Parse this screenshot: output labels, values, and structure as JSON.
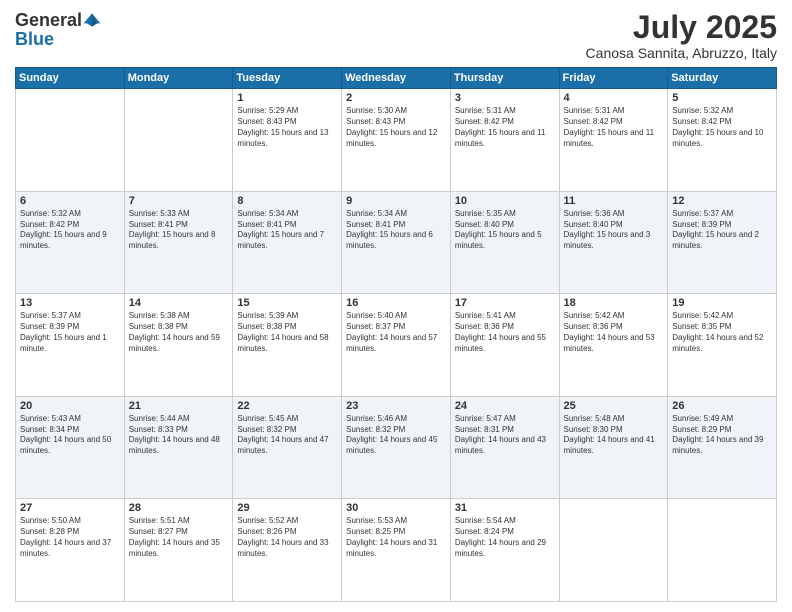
{
  "header": {
    "logo_general": "General",
    "logo_blue": "Blue",
    "month": "July 2025",
    "location": "Canosa Sannita, Abruzzo, Italy"
  },
  "days_of_week": [
    "Sunday",
    "Monday",
    "Tuesday",
    "Wednesday",
    "Thursday",
    "Friday",
    "Saturday"
  ],
  "weeks": [
    [
      {
        "day": "",
        "sunrise": "",
        "sunset": "",
        "daylight": ""
      },
      {
        "day": "",
        "sunrise": "",
        "sunset": "",
        "daylight": ""
      },
      {
        "day": "1",
        "sunrise": "Sunrise: 5:29 AM",
        "sunset": "Sunset: 8:43 PM",
        "daylight": "Daylight: 15 hours and 13 minutes."
      },
      {
        "day": "2",
        "sunrise": "Sunrise: 5:30 AM",
        "sunset": "Sunset: 8:43 PM",
        "daylight": "Daylight: 15 hours and 12 minutes."
      },
      {
        "day": "3",
        "sunrise": "Sunrise: 5:31 AM",
        "sunset": "Sunset: 8:42 PM",
        "daylight": "Daylight: 15 hours and 11 minutes."
      },
      {
        "day": "4",
        "sunrise": "Sunrise: 5:31 AM",
        "sunset": "Sunset: 8:42 PM",
        "daylight": "Daylight: 15 hours and 11 minutes."
      },
      {
        "day": "5",
        "sunrise": "Sunrise: 5:32 AM",
        "sunset": "Sunset: 8:42 PM",
        "daylight": "Daylight: 15 hours and 10 minutes."
      }
    ],
    [
      {
        "day": "6",
        "sunrise": "Sunrise: 5:32 AM",
        "sunset": "Sunset: 8:42 PM",
        "daylight": "Daylight: 15 hours and 9 minutes."
      },
      {
        "day": "7",
        "sunrise": "Sunrise: 5:33 AM",
        "sunset": "Sunset: 8:41 PM",
        "daylight": "Daylight: 15 hours and 8 minutes."
      },
      {
        "day": "8",
        "sunrise": "Sunrise: 5:34 AM",
        "sunset": "Sunset: 8:41 PM",
        "daylight": "Daylight: 15 hours and 7 minutes."
      },
      {
        "day": "9",
        "sunrise": "Sunrise: 5:34 AM",
        "sunset": "Sunset: 8:41 PM",
        "daylight": "Daylight: 15 hours and 6 minutes."
      },
      {
        "day": "10",
        "sunrise": "Sunrise: 5:35 AM",
        "sunset": "Sunset: 8:40 PM",
        "daylight": "Daylight: 15 hours and 5 minutes."
      },
      {
        "day": "11",
        "sunrise": "Sunrise: 5:36 AM",
        "sunset": "Sunset: 8:40 PM",
        "daylight": "Daylight: 15 hours and 3 minutes."
      },
      {
        "day": "12",
        "sunrise": "Sunrise: 5:37 AM",
        "sunset": "Sunset: 8:39 PM",
        "daylight": "Daylight: 15 hours and 2 minutes."
      }
    ],
    [
      {
        "day": "13",
        "sunrise": "Sunrise: 5:37 AM",
        "sunset": "Sunset: 8:39 PM",
        "daylight": "Daylight: 15 hours and 1 minute."
      },
      {
        "day": "14",
        "sunrise": "Sunrise: 5:38 AM",
        "sunset": "Sunset: 8:38 PM",
        "daylight": "Daylight: 14 hours and 59 minutes."
      },
      {
        "day": "15",
        "sunrise": "Sunrise: 5:39 AM",
        "sunset": "Sunset: 8:38 PM",
        "daylight": "Daylight: 14 hours and 58 minutes."
      },
      {
        "day": "16",
        "sunrise": "Sunrise: 5:40 AM",
        "sunset": "Sunset: 8:37 PM",
        "daylight": "Daylight: 14 hours and 57 minutes."
      },
      {
        "day": "17",
        "sunrise": "Sunrise: 5:41 AM",
        "sunset": "Sunset: 8:36 PM",
        "daylight": "Daylight: 14 hours and 55 minutes."
      },
      {
        "day": "18",
        "sunrise": "Sunrise: 5:42 AM",
        "sunset": "Sunset: 8:36 PM",
        "daylight": "Daylight: 14 hours and 53 minutes."
      },
      {
        "day": "19",
        "sunrise": "Sunrise: 5:42 AM",
        "sunset": "Sunset: 8:35 PM",
        "daylight": "Daylight: 14 hours and 52 minutes."
      }
    ],
    [
      {
        "day": "20",
        "sunrise": "Sunrise: 5:43 AM",
        "sunset": "Sunset: 8:34 PM",
        "daylight": "Daylight: 14 hours and 50 minutes."
      },
      {
        "day": "21",
        "sunrise": "Sunrise: 5:44 AM",
        "sunset": "Sunset: 8:33 PM",
        "daylight": "Daylight: 14 hours and 48 minutes."
      },
      {
        "day": "22",
        "sunrise": "Sunrise: 5:45 AM",
        "sunset": "Sunset: 8:32 PM",
        "daylight": "Daylight: 14 hours and 47 minutes."
      },
      {
        "day": "23",
        "sunrise": "Sunrise: 5:46 AM",
        "sunset": "Sunset: 8:32 PM",
        "daylight": "Daylight: 14 hours and 45 minutes."
      },
      {
        "day": "24",
        "sunrise": "Sunrise: 5:47 AM",
        "sunset": "Sunset: 8:31 PM",
        "daylight": "Daylight: 14 hours and 43 minutes."
      },
      {
        "day": "25",
        "sunrise": "Sunrise: 5:48 AM",
        "sunset": "Sunset: 8:30 PM",
        "daylight": "Daylight: 14 hours and 41 minutes."
      },
      {
        "day": "26",
        "sunrise": "Sunrise: 5:49 AM",
        "sunset": "Sunset: 8:29 PM",
        "daylight": "Daylight: 14 hours and 39 minutes."
      }
    ],
    [
      {
        "day": "27",
        "sunrise": "Sunrise: 5:50 AM",
        "sunset": "Sunset: 8:28 PM",
        "daylight": "Daylight: 14 hours and 37 minutes."
      },
      {
        "day": "28",
        "sunrise": "Sunrise: 5:51 AM",
        "sunset": "Sunset: 8:27 PM",
        "daylight": "Daylight: 14 hours and 35 minutes."
      },
      {
        "day": "29",
        "sunrise": "Sunrise: 5:52 AM",
        "sunset": "Sunset: 8:26 PM",
        "daylight": "Daylight: 14 hours and 33 minutes."
      },
      {
        "day": "30",
        "sunrise": "Sunrise: 5:53 AM",
        "sunset": "Sunset: 8:25 PM",
        "daylight": "Daylight: 14 hours and 31 minutes."
      },
      {
        "day": "31",
        "sunrise": "Sunrise: 5:54 AM",
        "sunset": "Sunset: 8:24 PM",
        "daylight": "Daylight: 14 hours and 29 minutes."
      },
      {
        "day": "",
        "sunrise": "",
        "sunset": "",
        "daylight": ""
      },
      {
        "day": "",
        "sunrise": "",
        "sunset": "",
        "daylight": ""
      }
    ]
  ]
}
